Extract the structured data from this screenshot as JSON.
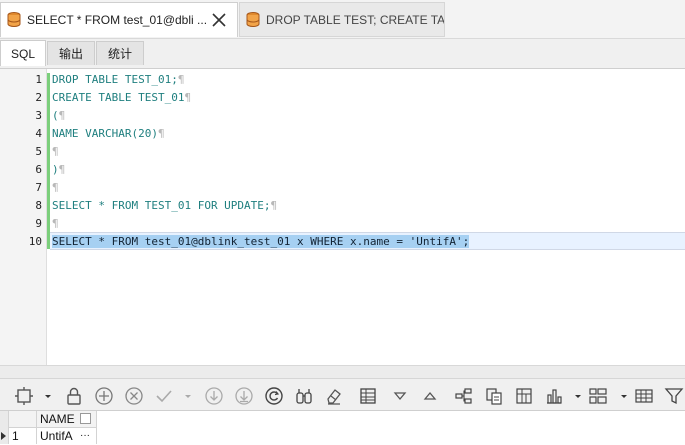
{
  "document_tabs": [
    {
      "label": "SELECT * FROM test_01@dbli ...",
      "active": true,
      "icon": "database-script-icon"
    },
    {
      "label": "DROP TABLE TEST; CREATE TA ...",
      "active": false,
      "icon": "database-script-icon"
    }
  ],
  "sub_tabs": [
    {
      "label": "SQL",
      "active": true
    },
    {
      "label": "输出",
      "active": false
    },
    {
      "label": "统计",
      "active": false
    }
  ],
  "editor": {
    "lines": [
      {
        "num": "1",
        "code": "DROP TABLE TEST_01;",
        "pilcrow": "¶"
      },
      {
        "num": "2",
        "code": "CREATE TABLE TEST_01",
        "pilcrow": "¶"
      },
      {
        "num": "3",
        "code": "(",
        "pilcrow": "¶"
      },
      {
        "num": "4",
        "code": "NAME VARCHAR(20)",
        "pilcrow": "¶"
      },
      {
        "num": "5",
        "code": "",
        "pilcrow": "¶"
      },
      {
        "num": "6",
        "code": ")",
        "pilcrow": "¶"
      },
      {
        "num": "7",
        "code": "",
        "pilcrow": "¶"
      },
      {
        "num": "8",
        "code": "SELECT * FROM TEST_01 FOR UPDATE;",
        "pilcrow": "¶"
      },
      {
        "num": "9",
        "code": "",
        "pilcrow": "¶"
      },
      {
        "num": "10",
        "code": "SELECT * FROM test_01@dblink_test_01 x WHERE x.name = 'UntifA';",
        "pilcrow": ""
      }
    ],
    "selected_line": "10"
  },
  "toolbar": {
    "icons": [
      "grid-options-icon",
      "dropdown-arrow-icon",
      "lock-icon",
      "add-record-icon",
      "delete-record-icon",
      "post-record-icon",
      "dropdown-arrow-icon",
      "fetch-next-icon",
      "fetch-all-icon",
      "refresh-icon",
      "find-icon",
      "clear-icon",
      "table-view-icon",
      "sort-desc-icon",
      "sort-asc-icon",
      "tree-icon",
      "export-icon",
      "excel-icon",
      "chart-icon",
      "dropdown-arrow-icon",
      "layout-icon",
      "dropdown-arrow-icon",
      "grid-icon",
      "filter-icon"
    ]
  },
  "result_grid": {
    "columns": [
      "NAME"
    ],
    "rows": [
      {
        "row_num": "1",
        "NAME": "UntifA",
        "ellipsis": "···"
      }
    ]
  },
  "colors": {
    "keyword": "#1f7f7f",
    "selection": "#a6d0f2",
    "change_bar": "#7ccf7c"
  }
}
